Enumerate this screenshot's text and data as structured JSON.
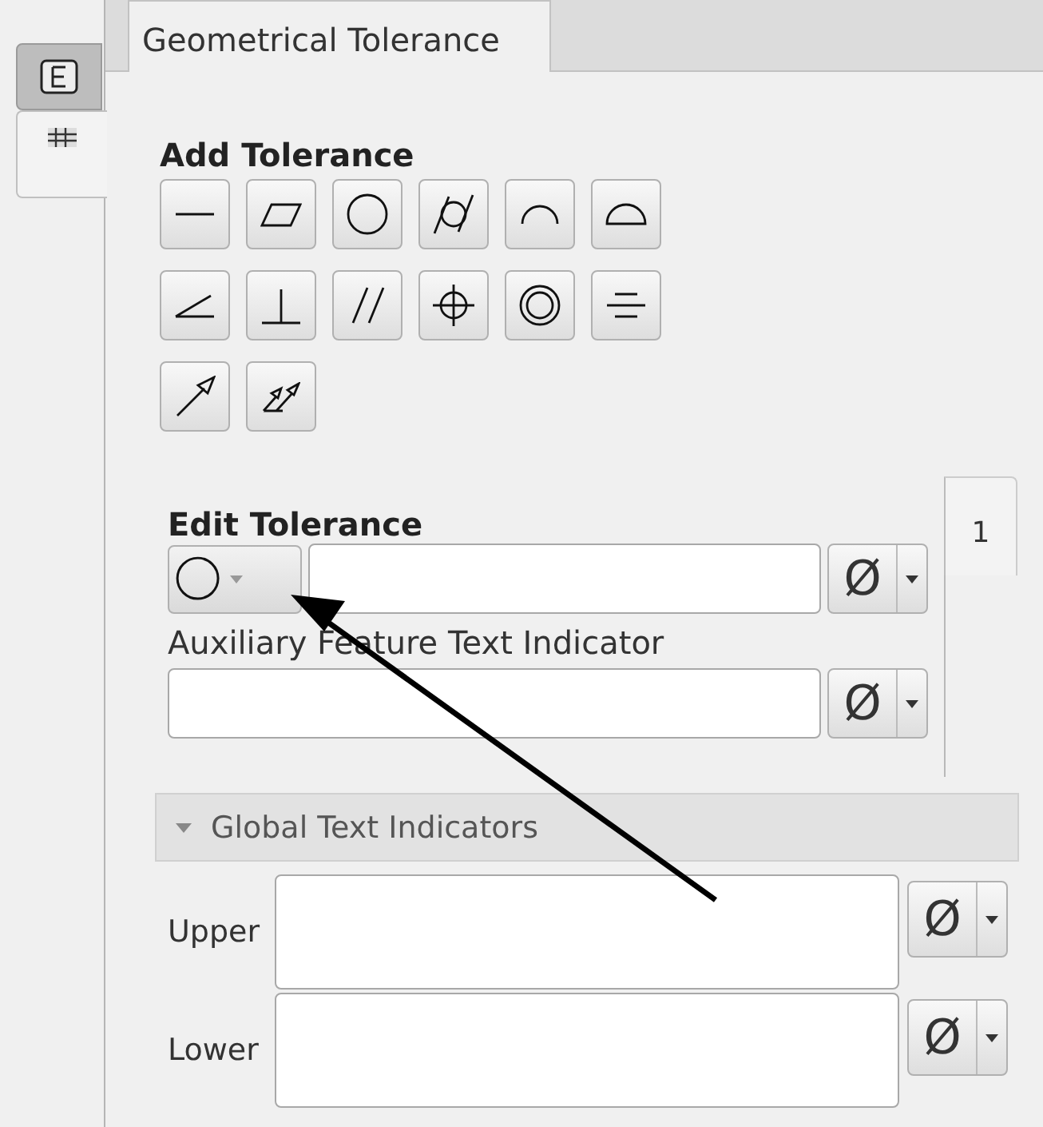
{
  "side_tabs": [
    {
      "kind": "tree",
      "selected": false
    },
    {
      "kind": "table",
      "selected": true
    }
  ],
  "tabs": [
    {
      "label": "Geometrical Tolerance",
      "selected": true
    }
  ],
  "add_tolerance": {
    "title": "Add Tolerance",
    "symbols": [
      {
        "kind": "straightness"
      },
      {
        "kind": "flatness"
      },
      {
        "kind": "circularity"
      },
      {
        "kind": "cylindricity"
      },
      {
        "kind": "profile_line"
      },
      {
        "kind": "profile_surface"
      },
      {
        "kind": "angularity"
      },
      {
        "kind": "perpendicularity"
      },
      {
        "kind": "parallelism"
      },
      {
        "kind": "position"
      },
      {
        "kind": "concentricity"
      },
      {
        "kind": "symmetry"
      },
      {
        "kind": "circular_runout"
      },
      {
        "kind": "total_runout"
      }
    ]
  },
  "edit_tolerance": {
    "title": "Edit Tolerance",
    "page_tab": "1",
    "symbol": {
      "kind": "circularity"
    },
    "diameter": "Ø",
    "auxiliary_label": "Auxiliary Feature Text Indicator",
    "auxiliary_diameter": "Ø"
  },
  "global_text_indicators": {
    "title": "Global Text Indicators",
    "expanded": true,
    "rows": [
      {
        "label": "Upper",
        "diameter": "Ø"
      },
      {
        "label": "Lower",
        "diameter": "Ø"
      }
    ]
  }
}
